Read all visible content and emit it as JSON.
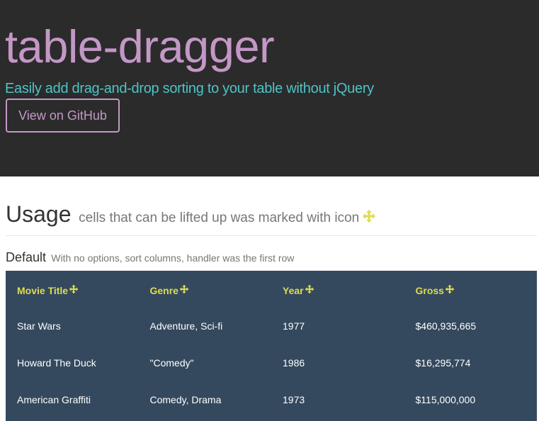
{
  "hero": {
    "title": "table-dragger",
    "tagline": "Easily add drag-and-drop sorting to your table without jQuery",
    "github_button": "View on GitHub"
  },
  "usage": {
    "title": "Usage",
    "subtitle": "cells that can be lifted up was marked with icon",
    "icon": "move-icon"
  },
  "default_section": {
    "title": "Default",
    "subtitle": "With no options, sort columns, handler was the first row"
  },
  "table": {
    "columns": [
      "Movie Title",
      "Genre",
      "Year",
      "Gross"
    ],
    "rows": [
      [
        "Star Wars",
        "Adventure, Sci-fi",
        "1977",
        "$460,935,665"
      ],
      [
        "Howard The Duck",
        "\"Comedy\"",
        "1986",
        "$16,295,774"
      ],
      [
        "American Graffiti",
        "Comedy, Drama",
        "1973",
        "$115,000,000"
      ]
    ]
  },
  "colors": {
    "hero_bg": "#2b2b2b",
    "accent_purple": "#c497c7",
    "accent_teal": "#4fc3c6",
    "table_bg": "#34495e",
    "table_header": "#dcdc53"
  }
}
